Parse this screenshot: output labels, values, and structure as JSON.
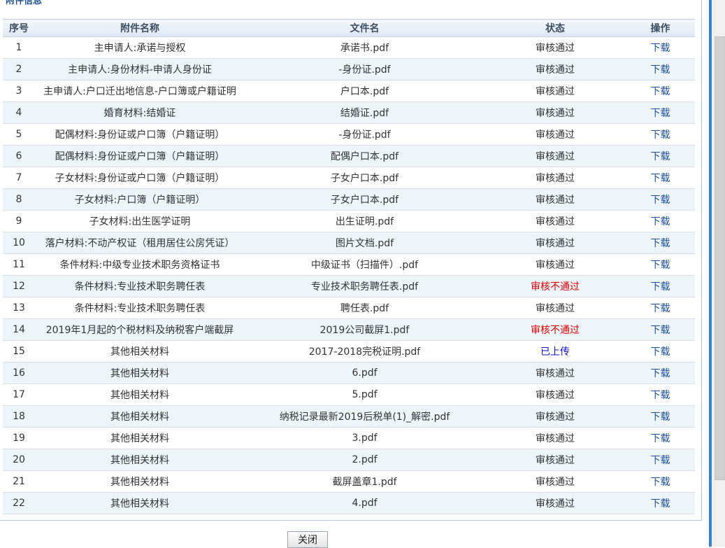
{
  "section": {
    "title": "附件信息"
  },
  "table": {
    "headers": [
      "序号",
      "附件名称",
      "文件名",
      "状态",
      "操作"
    ],
    "rows": [
      {
        "no": "1",
        "name": "主申请人:承诺与授权",
        "file": "承诺书.pdf",
        "status": "审核通过",
        "status_type": "pass",
        "action": "下载"
      },
      {
        "no": "2",
        "name": "主申请人:身份材料-申请人身份证",
        "file": "-身份证.pdf",
        "status": "审核通过",
        "status_type": "pass",
        "action": "下载"
      },
      {
        "no": "3",
        "name": "主申请人:户口迁出地信息-户口簿或户籍证明",
        "file": "户口本.pdf",
        "status": "审核通过",
        "status_type": "pass",
        "action": "下载"
      },
      {
        "no": "4",
        "name": "婚育材料:结婚证",
        "file": "结婚证.pdf",
        "status": "审核通过",
        "status_type": "pass",
        "action": "下载"
      },
      {
        "no": "5",
        "name": "配偶材料:身份证或户口簿（户籍证明）",
        "file": "-身份证.pdf",
        "status": "审核通过",
        "status_type": "pass",
        "action": "下载"
      },
      {
        "no": "6",
        "name": "配偶材料:身份证或户口簿（户籍证明）",
        "file": "配偶户口本.pdf",
        "status": "审核通过",
        "status_type": "pass",
        "action": "下载"
      },
      {
        "no": "7",
        "name": "子女材料:身份证或户口簿（户籍证明）",
        "file": "子女户口本.pdf",
        "status": "审核通过",
        "status_type": "pass",
        "action": "下载"
      },
      {
        "no": "8",
        "name": "子女材料:户口簿（户籍证明）",
        "file": "子女户口本.pdf",
        "status": "审核通过",
        "status_type": "pass",
        "action": "下载"
      },
      {
        "no": "9",
        "name": "子女材料:出生医学证明",
        "file": "出生证明.pdf",
        "status": "审核通过",
        "status_type": "pass",
        "action": "下载"
      },
      {
        "no": "10",
        "name": "落户材料:不动产权证（租用居住公房凭证）",
        "file": "图片文档.pdf",
        "status": "审核通过",
        "status_type": "pass",
        "action": "下载"
      },
      {
        "no": "11",
        "name": "条件材料:中级专业技术职务资格证书",
        "file": "中级证书（扫描件）.pdf",
        "status": "审核通过",
        "status_type": "pass",
        "action": "下载"
      },
      {
        "no": "12",
        "name": "条件材料:专业技术职务聘任表",
        "file": "专业技术职务聘任表.pdf",
        "status": "审核不通过",
        "status_type": "fail",
        "action": "下载"
      },
      {
        "no": "13",
        "name": "条件材料:专业技术职务聘任表",
        "file": "聘任表.pdf",
        "status": "审核通过",
        "status_type": "pass",
        "action": "下载"
      },
      {
        "no": "14",
        "name": "2019年1月起的个税材料及纳税客户端截屏",
        "file": "2019公司截屏1.pdf",
        "status": "审核不通过",
        "status_type": "fail",
        "action": "下载"
      },
      {
        "no": "15",
        "name": "其他相关材料",
        "file": "2017-2018完税证明.pdf",
        "status": "已上传",
        "status_type": "uploaded",
        "action": "下载"
      },
      {
        "no": "16",
        "name": "其他相关材料",
        "file": "6.pdf",
        "status": "审核通过",
        "status_type": "pass",
        "action": "下载"
      },
      {
        "no": "17",
        "name": "其他相关材料",
        "file": "5.pdf",
        "status": "审核通过",
        "status_type": "pass",
        "action": "下载"
      },
      {
        "no": "18",
        "name": "其他相关材料",
        "file": "纳税记录最新2019后税单(1)_解密.pdf",
        "status": "审核通过",
        "status_type": "pass",
        "action": "下载"
      },
      {
        "no": "19",
        "name": "其他相关材料",
        "file": "3.pdf",
        "status": "审核通过",
        "status_type": "pass",
        "action": "下载"
      },
      {
        "no": "20",
        "name": "其他相关材料",
        "file": "2.pdf",
        "status": "审核通过",
        "status_type": "pass",
        "action": "下载"
      },
      {
        "no": "21",
        "name": "其他相关材料",
        "file": "截屏盖章1.pdf",
        "status": "审核通过",
        "status_type": "pass",
        "action": "下载"
      },
      {
        "no": "22",
        "name": "其他相关材料",
        "file": "4.pdf",
        "status": "审核通过",
        "status_type": "pass",
        "action": "下载"
      }
    ]
  },
  "footer": {
    "close_label": "关闭"
  },
  "colors": {
    "pass": "#0a7a0a",
    "fail": "#e00000",
    "uploaded": "#1010c8",
    "link": "#1a4f9c"
  }
}
